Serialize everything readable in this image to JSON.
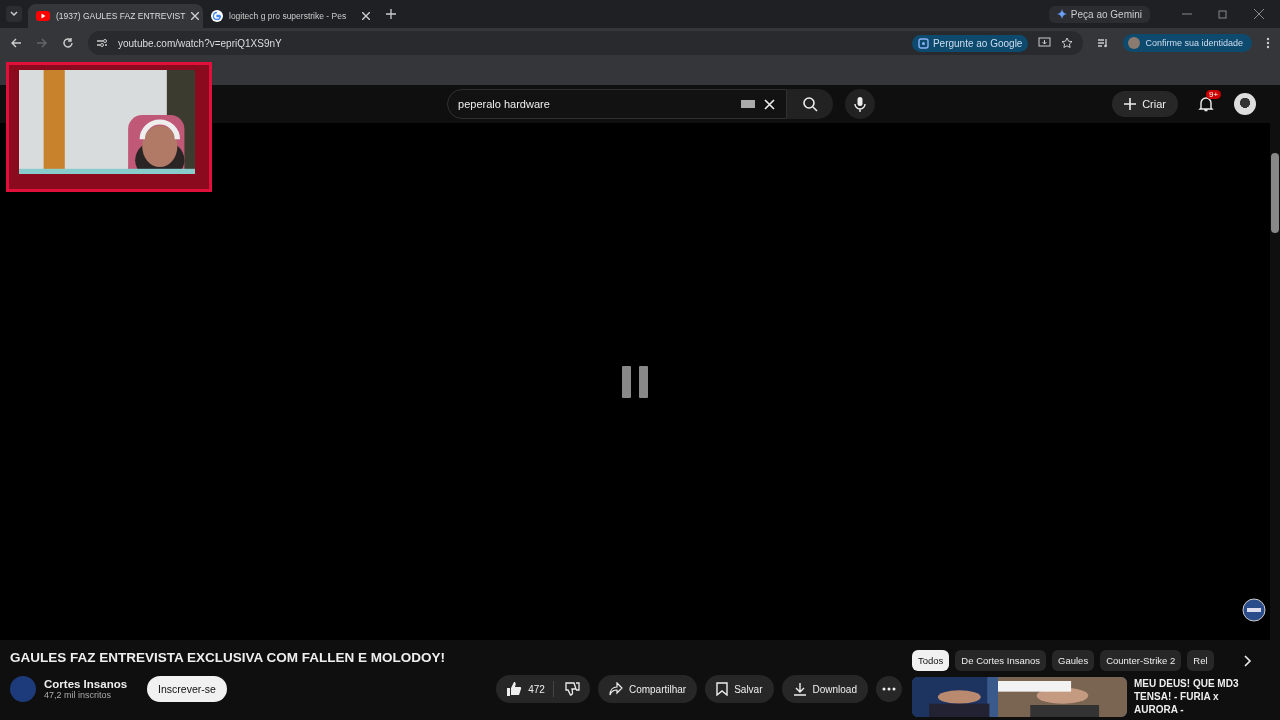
{
  "browser": {
    "tabs": [
      {
        "title": "(1937) GAULES FAZ ENTREVIST",
        "kind": "video",
        "selected": true
      },
      {
        "title": "logitech g pro superstrike - Pes",
        "kind": "search",
        "selected": false
      }
    ],
    "gemini": "Peça ao Gemini",
    "url": "youtube.com/watch?v=epriQ1XS9nY",
    "ask_google": "Pergunte ao Google",
    "identity": "Confirme sua identidade"
  },
  "youtube": {
    "search": {
      "value": "peperalo hardware"
    },
    "create": "Criar",
    "notifications": "9+"
  },
  "player": {
    "paused": true
  },
  "video": {
    "title": "GAULES FAZ ENTREVISTA EXCLUSIVA COM FALLEN E MOLODOY!",
    "channel": "Cortes Insanos",
    "subscribers": "47,2 mil inscritos",
    "subscribe": "Inscrever-se",
    "likes": "472",
    "share": "Compartilhar",
    "save": "Salvar",
    "download": "Download"
  },
  "chips": [
    {
      "label": "Todos",
      "selected": true
    },
    {
      "label": "De Cortes Insanos",
      "selected": false
    },
    {
      "label": "Gaules",
      "selected": false
    },
    {
      "label": "Counter-Strike 2",
      "selected": false
    },
    {
      "label": "Rel",
      "selected": false
    }
  ],
  "recommendations": [
    {
      "title": "MEU DEUS! QUE MD3 TENSA! - FURIA x AURORA -",
      "kind": "picture"
    }
  ]
}
